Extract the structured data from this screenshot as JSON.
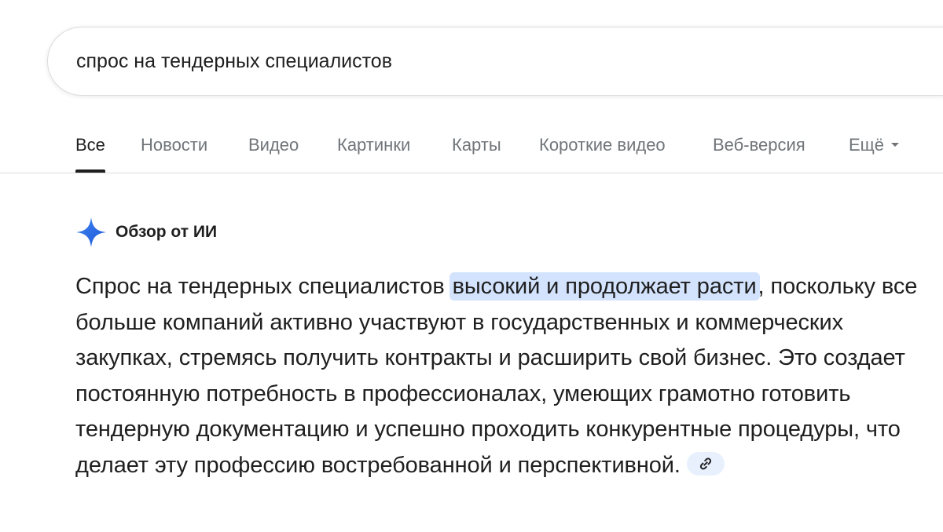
{
  "search": {
    "query": "спрос на тендерных специалистов"
  },
  "tabs": [
    {
      "label": "Все",
      "active": true
    },
    {
      "label": "Новости",
      "active": false
    },
    {
      "label": "Видео",
      "active": false
    },
    {
      "label": "Картинки",
      "active": false
    },
    {
      "label": "Карты",
      "active": false
    },
    {
      "label": "Короткие видео",
      "active": false
    },
    {
      "label": "Веб-версия",
      "active": false
    },
    {
      "label": "Ещё",
      "active": false
    }
  ],
  "ai_overview": {
    "title": "Обзор от ИИ",
    "text_before": "Спрос на тендерных специалистов ",
    "text_highlight": "высокий и продолжает расти",
    "text_after": ", поскольку все больше компаний активно участвуют в государственных и коммерческих закупках, стремясь получить контракты и расширить свой бизнес. Это создает постоянную потребность в профессионалах, умеющих грамотно готовить тендерную документацию и успешно проходить конкурентные процедуры, что делает эту профессию востребованной и перспективной."
  },
  "colors": {
    "accent": "#1a73e8",
    "highlight": "#d3e3fd",
    "tab_inactive": "#70757a",
    "text": "#1f1f1f"
  }
}
